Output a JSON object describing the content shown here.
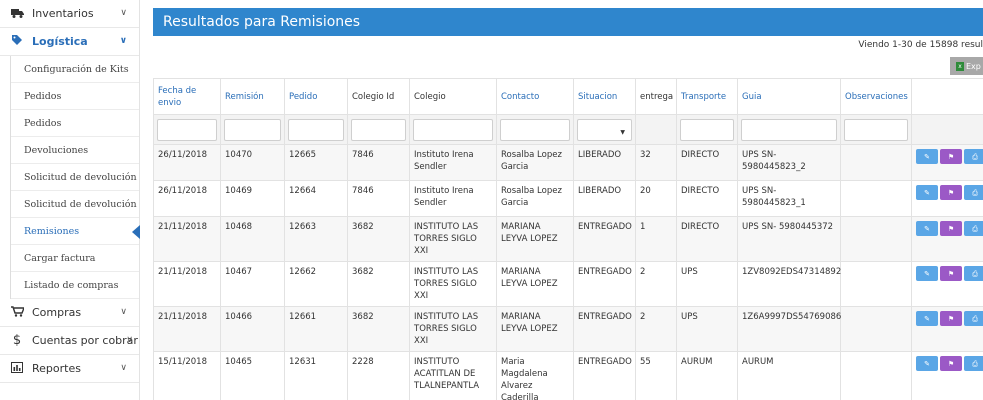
{
  "sidebar": {
    "top_items": [
      {
        "label": "Inventarios",
        "icon": "truck-icon"
      },
      {
        "label": "Logística",
        "icon": "tag-icon"
      }
    ],
    "sub_items": [
      {
        "label": "Configuración de Kits"
      },
      {
        "label": "Pedidos"
      },
      {
        "label": "Pedidos"
      },
      {
        "label": "Devoluciones"
      },
      {
        "label": "Solicitud de devolución"
      },
      {
        "label": "Solicitud de devolución"
      },
      {
        "label": "Remisiones"
      },
      {
        "label": "Cargar factura"
      },
      {
        "label": "Listado de compras"
      }
    ],
    "bottom_items": [
      {
        "label": "Compras",
        "icon": "cart-icon"
      },
      {
        "label": "Cuentas por cobrar",
        "icon": "dollar-icon"
      },
      {
        "label": "Reportes",
        "icon": "bar-chart-icon"
      }
    ]
  },
  "main": {
    "title": "Resultados para Remisiones",
    "viewing": "Viendo 1-30 de 15898 resul",
    "export_label": "Exp",
    "columns": [
      "Fecha de envio",
      "Remisión",
      "Pedido",
      "Colegio Id",
      "Colegio",
      "Contacto",
      "Situacion",
      "entrega",
      "Transporte",
      "Guia",
      "Observaciones",
      ""
    ],
    "rows": [
      {
        "fecha": "26/11/2018",
        "remision": "10470",
        "pedido": "12665",
        "colegio_id": "7846",
        "colegio": "Instituto Irena Sendler",
        "contacto": "Rosalba Lopez Garcia",
        "situacion": "LIBERADO",
        "entrega": "32",
        "transporte": "DIRECTO",
        "guia": "UPS SN-5980445823_2",
        "observaciones": ""
      },
      {
        "fecha": "26/11/2018",
        "remision": "10469",
        "pedido": "12664",
        "colegio_id": "7846",
        "colegio": "Instituto Irena Sendler",
        "contacto": "Rosalba Lopez Garcia",
        "situacion": "LIBERADO",
        "entrega": "20",
        "transporte": "DIRECTO",
        "guia": "UPS SN-5980445823_1",
        "observaciones": ""
      },
      {
        "fecha": "21/11/2018",
        "remision": "10468",
        "pedido": "12663",
        "colegio_id": "3682",
        "colegio": "INSTITUTO LAS TORRES SIGLO XXI",
        "contacto": "MARIANA LEYVA LOPEZ",
        "situacion": "ENTREGADO",
        "entrega": "1",
        "transporte": "DIRECTO",
        "guia": "UPS SN- 5980445372",
        "observaciones": ""
      },
      {
        "fecha": "21/11/2018",
        "remision": "10467",
        "pedido": "12662",
        "colegio_id": "3682",
        "colegio": "INSTITUTO LAS TORRES SIGLO XXI",
        "contacto": "MARIANA LEYVA LOPEZ",
        "situacion": "ENTREGADO",
        "entrega": "2",
        "transporte": "UPS",
        "guia": "1ZV8092EDS47314892",
        "observaciones": ""
      },
      {
        "fecha": "21/11/2018",
        "remision": "10466",
        "pedido": "12661",
        "colegio_id": "3682",
        "colegio": "INSTITUTO LAS TORRES SIGLO XXI",
        "contacto": "MARIANA LEYVA LOPEZ",
        "situacion": "ENTREGADO",
        "entrega": "2",
        "transporte": "UPS",
        "guia": "1Z6A9997DS54769086",
        "observaciones": ""
      },
      {
        "fecha": "15/11/2018",
        "remision": "10465",
        "pedido": "12631",
        "colegio_id": "2228",
        "colegio": "INSTITUTO ACATITLAN DE TLALNEPANTLA",
        "contacto": "Maria Magdalena Alvarez Caderilla",
        "situacion": "ENTREGADO",
        "entrega": "55",
        "transporte": "AURUM",
        "guia": "AURUM",
        "observaciones": ""
      }
    ],
    "colors": {
      "header_bg": "#2f86cd",
      "link": "#2a6eb8",
      "edit": "#5aa6e6",
      "flag": "#9b59c6",
      "print": "#5aa6e6"
    }
  }
}
